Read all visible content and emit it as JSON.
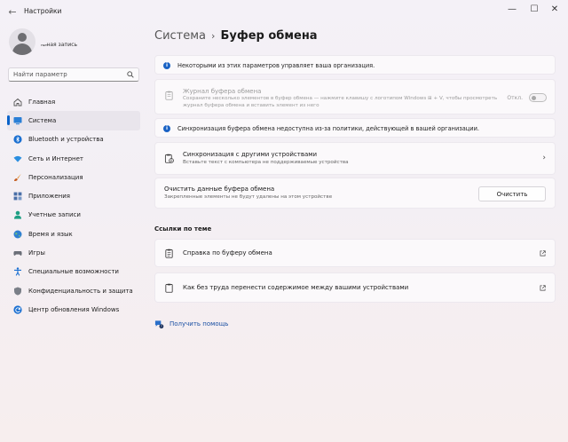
{
  "window": {
    "title": "Настройки",
    "minimize": "—",
    "maximize": "☐",
    "close": "✕",
    "back": "←"
  },
  "account": {
    "name_scribble": "ᵣᵤₑ",
    "name_suffix": "ная запись"
  },
  "search": {
    "placeholder": "Найти параметр"
  },
  "sidebar": {
    "items": [
      {
        "label": "Главная",
        "icon": "home-icon"
      },
      {
        "label": "Система",
        "icon": "system-icon",
        "active": true
      },
      {
        "label": "Bluetooth и устройства",
        "icon": "bluetooth-icon"
      },
      {
        "label": "Сеть и Интернет",
        "icon": "wifi-icon"
      },
      {
        "label": "Персонализация",
        "icon": "brush-icon"
      },
      {
        "label": "Приложения",
        "icon": "apps-icon"
      },
      {
        "label": "Учетные записи",
        "icon": "person-icon"
      },
      {
        "label": "Время и язык",
        "icon": "globe-icon"
      },
      {
        "label": "Игры",
        "icon": "gamepad-icon"
      },
      {
        "label": "Специальные возможности",
        "icon": "accessibility-icon"
      },
      {
        "label": "Конфиденциальность и защита",
        "icon": "shield-icon"
      },
      {
        "label": "Центр обновления Windows",
        "icon": "update-icon"
      }
    ]
  },
  "breadcrumb": {
    "parent": "Система",
    "separator": "›",
    "current": "Буфер обмена"
  },
  "notices": {
    "org_managed": "Некоторыми из этих параметров управляет ваша организация.",
    "sync_unavailable": "Синхронизация буфера обмена недоступна из-за политики, действующей в вашей организации."
  },
  "history": {
    "title": "Журнал буфера обмена",
    "description": "Сохраните несколько элементов в буфер обмена — нажмите клавишу с логотипом Windows ⊞ + V, чтобы просмотреть журнал буфера обмена и вставить элемент из него",
    "toggle_label": "Откл.",
    "enabled": false
  },
  "sync": {
    "title": "Синхронизация с другими устройствами",
    "description": "Вставьте текст с компьютера не поддерживаемые устройства"
  },
  "clear": {
    "title": "Очистить данные буфера обмена",
    "description": "Закрепленные элементы не будут удалены на этом устройстве",
    "button": "Очистить"
  },
  "related": {
    "heading": "Ссылки по теме",
    "links": [
      {
        "label": "Справка по буферу обмена"
      },
      {
        "label": "Как без труда перенести содержимое между вашими устройствами"
      }
    ]
  },
  "help": {
    "label": "Получить помощь"
  },
  "colors": {
    "accent": "#0a63c9",
    "info": "#1a62c4"
  }
}
